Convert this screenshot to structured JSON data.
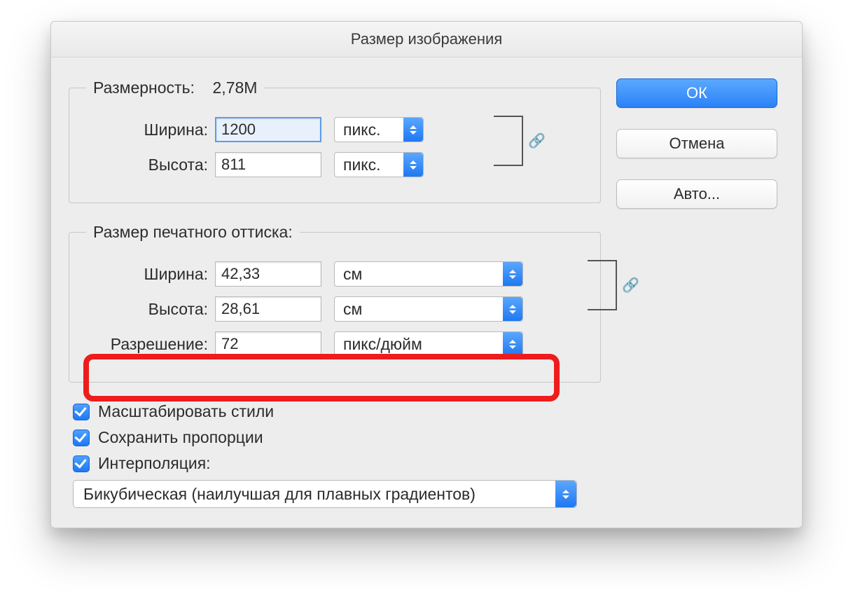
{
  "title": "Размер изображения",
  "pixelGroup": {
    "legend_label": "Размерность:",
    "legend_value": "2,78M",
    "width_label": "Ширина:",
    "width_value": "1200",
    "width_unit": "пикс.",
    "height_label": "Высота:",
    "height_value": "811",
    "height_unit": "пикс."
  },
  "printGroup": {
    "legend": "Размер печатного оттиска:",
    "width_label": "Ширина:",
    "width_value": "42,33",
    "width_unit": "см",
    "height_label": "Высота:",
    "height_value": "28,61",
    "height_unit": "см",
    "res_label": "Разрешение:",
    "res_value": "72",
    "res_unit": "пикс/дюйм"
  },
  "checks": {
    "scale_styles": "Масштабировать стили",
    "constrain": "Сохранить пропорции",
    "interpolation": "Интерполяция:"
  },
  "interp_method": "Бикубическая (наилучшая для плавных градиентов)",
  "buttons": {
    "ok": "ОК",
    "cancel": "Отмена",
    "auto": "Авто..."
  },
  "link_glyph": "🔗"
}
